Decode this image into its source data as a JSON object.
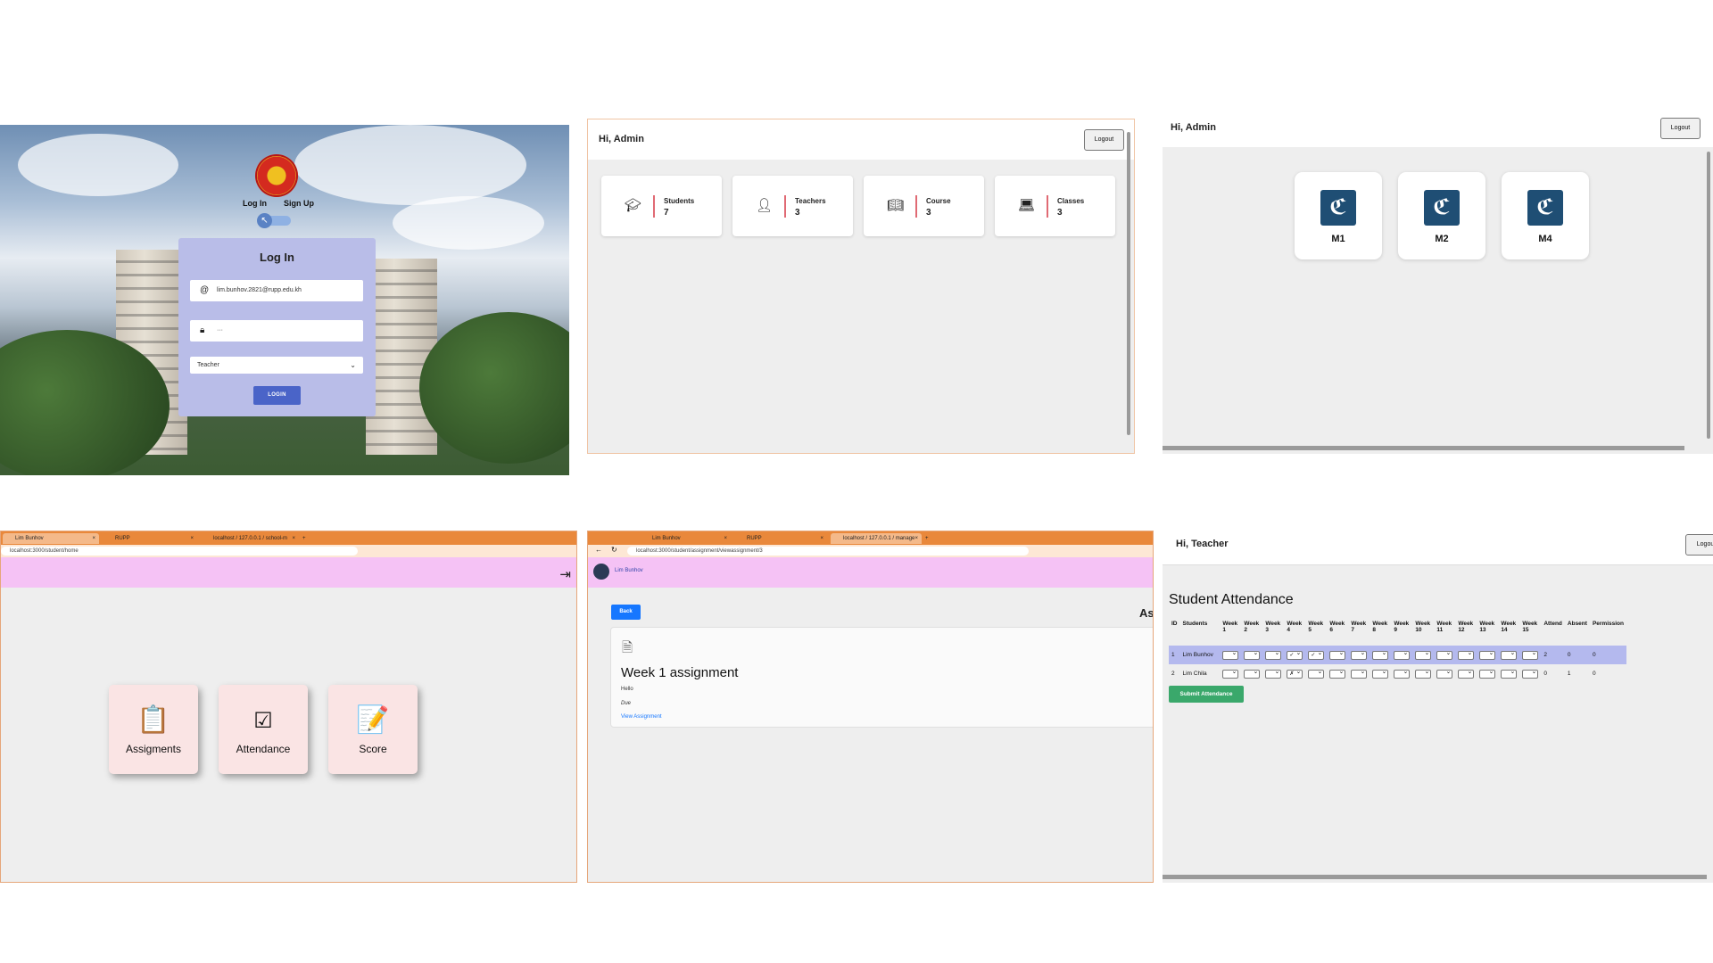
{
  "login": {
    "tab_login": "Log In",
    "tab_signup": "Sign Up",
    "title": "Log In",
    "email_value": "lim.bunhov.2821@rupp.edu.kh",
    "password_value": "···",
    "role_value": "Teacher",
    "button": "LOGIN"
  },
  "admin": {
    "greeting": "Hi, Admin",
    "logout": "Logout",
    "stats": [
      {
        "label": "Students",
        "value": "7",
        "icon": "graduation-cap-icon"
      },
      {
        "label": "Teachers",
        "value": "3",
        "icon": "teacher-icon"
      },
      {
        "label": "Course",
        "value": "3",
        "icon": "book-icon"
      },
      {
        "label": "Classes",
        "value": "3",
        "icon": "laptop-icon"
      }
    ]
  },
  "classes": {
    "greeting": "Hi, Admin",
    "logout": "Logout",
    "items": [
      {
        "name": "M1"
      },
      {
        "name": "M2"
      },
      {
        "name": "M4"
      }
    ],
    "logo_glyph": "ℭ"
  },
  "student_home": {
    "tabs": [
      "Lim Bunhov",
      "RUPP",
      "localhost / 127.0.0.1 / school-m"
    ],
    "url": "localhost:3000/student/home",
    "menu": [
      {
        "label": "Assigments",
        "icon": "clipboard-icon"
      },
      {
        "label": "Attendance",
        "icon": "checklist-icon"
      },
      {
        "label": "Score",
        "icon": "score-sheet-icon"
      }
    ]
  },
  "assignment": {
    "tabs": [
      "Lim Bunhov",
      "RUPP",
      "localhost / 127.0.0.1 / manage"
    ],
    "url": "localhost:3000/student/assignment/viewassignment/3",
    "user": "Lim Bunhov",
    "back": "Back",
    "heading": "As",
    "title": "Week 1 assignment",
    "description": "Hello",
    "due": "Due",
    "link": "View Assignment"
  },
  "attendance": {
    "greeting": "Hi, Teacher",
    "logout": "Logou",
    "title": "Student Attendance",
    "headers": {
      "id": "ID",
      "students": "Students",
      "week_prefix": "Week",
      "attend": "Attend",
      "absent": "Absent",
      "permission": "Permission"
    },
    "weeks": [
      "1",
      "2",
      "3",
      "4",
      "5",
      "6",
      "7",
      "8",
      "9",
      "10",
      "11",
      "12",
      "13",
      "14",
      "15"
    ],
    "rows": [
      {
        "id": "1",
        "name": "Lim Bunhov",
        "marks": [
          "",
          "",
          "",
          "✓",
          "✓",
          "",
          "",
          "",
          "",
          "",
          "",
          "",
          "",
          "",
          ""
        ],
        "attend": "2",
        "absent": "0",
        "permission": "0"
      },
      {
        "id": "2",
        "name": "Lim Chila",
        "marks": [
          "",
          "",
          "",
          "✗",
          "",
          "",
          "",
          "",
          "",
          "",
          "",
          "",
          "",
          "",
          ""
        ],
        "attend": "0",
        "absent": "1",
        "permission": "0"
      }
    ],
    "submit": "Submit Attendance"
  },
  "colors": {
    "accent_blue": "#4a64c8",
    "pink_header": "#f5c2f5",
    "browser_orange": "#e9883b",
    "submit_green": "#3aa86b",
    "highlight_row": "#b4b9ee",
    "class_logo": "#1f4e74"
  }
}
